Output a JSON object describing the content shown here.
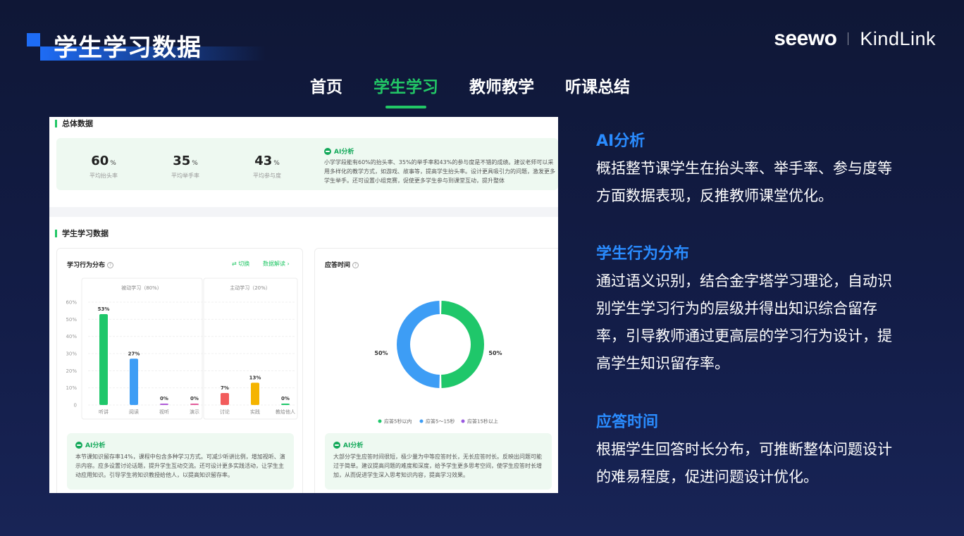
{
  "header": {
    "title": "学生学习数据",
    "brand_left": "seewo",
    "brand_right": "KindLink"
  },
  "nav": {
    "tabs": [
      {
        "label": "首页",
        "active": false
      },
      {
        "label": "学生学习",
        "active": true
      },
      {
        "label": "教师教学",
        "active": false
      },
      {
        "label": "听课总结",
        "active": false
      }
    ]
  },
  "overall": {
    "section_title": "总体数据",
    "stats": [
      {
        "value": "60",
        "unit": "%",
        "label": "平均抬头率"
      },
      {
        "value": "35",
        "unit": "%",
        "label": "平均举手率"
      },
      {
        "value": "43",
        "unit": "%",
        "label": "平均参与度"
      }
    ],
    "ai_label": "AI分析",
    "ai_text": "小学学段能有60%的抬头率、35%的举手率和43%的参与度是不错的成绩。建议老师可以采用多样化的教学方式，如游戏、故事等，提高学生抬头率。设计更具吸引力的问题，激发更多学生举手。还可设置小组竞赛，促使更多学生参与到课堂互动，提升整体"
  },
  "student": {
    "section_title": "学生学习数据",
    "behavior": {
      "title": "学习行为分布",
      "switch_label": "⇄ 切换",
      "data_label": "数据解读 ›",
      "passive_label": "被动学习（80%）",
      "active_label": "主动学习（20%）",
      "ai_label": "AI分析",
      "ai_text": "本节课知识留存率14%，课程中包含多种学习方式。可减少听讲比例，增加视听、演示内容。应多设置讨论话题，提升学生互动交流。还可设计更多实践活动，让学生主动应用知识。引导学生将知识教授给他人，以提高知识留存率。"
    },
    "response": {
      "title": "应答时间",
      "ai_label": "AI分析",
      "ai_text": "大部分学生应答时间很短，极少量为中等应答时长，无长应答时长。反映出问题可能过于简单。建议提高问题的难度和深度，给予学生更多思考空间，使学生应答时长增加，从而促进学生深入思考知识内容，提高学习效果。"
    }
  },
  "chart_data": [
    {
      "type": "bar",
      "title": "学习行为分布",
      "categories": [
        "听讲",
        "阅读",
        "视听",
        "演示",
        "讨论",
        "实践",
        "教给他人"
      ],
      "values": [
        53,
        27,
        0,
        0,
        7,
        13,
        0
      ],
      "value_labels": [
        "53%",
        "27%",
        "0%",
        "0%",
        "7%",
        "13%",
        "0%"
      ],
      "colors": [
        "#1fc76a",
        "#3d9df5",
        "#b05ad8",
        "#e25a9a",
        "#f25c5c",
        "#f5b400",
        "#1fc76a"
      ],
      "yticks": [
        "0",
        "10%",
        "20%",
        "30%",
        "40%",
        "50%",
        "60%"
      ],
      "ylim": [
        0,
        60
      ],
      "groups": [
        {
          "name": "被动学习（80%）",
          "categories": [
            "听讲",
            "阅读",
            "视听",
            "演示"
          ]
        },
        {
          "name": "主动学习（20%）",
          "categories": [
            "讨论",
            "实践",
            "教给他人"
          ]
        }
      ],
      "grid": true
    },
    {
      "type": "pie",
      "title": "应答时间",
      "labels": [
        "应答5秒以内",
        "应答5～15秒",
        "应答15秒以上"
      ],
      "values": [
        50,
        50,
        0
      ],
      "value_labels": [
        "50%",
        "50%"
      ],
      "colors": [
        "#1fc76a",
        "#3d9df5",
        "#9a5ae0"
      ],
      "legend": "bottom"
    }
  ],
  "descriptions": [
    {
      "title": "AI分析",
      "text": "概括整节课学生在抬头率、举手率、参与度等方面数据表现，反推教师课堂优化。"
    },
    {
      "title": "学生行为分布",
      "text": "通过语义识别，结合金字塔学习理论，自动识别学生学习行为的层级并得出知识综合留存率，引导教师通过更高层的学习行为设计，提高学生知识留存率。"
    },
    {
      "title": "应答时间",
      "text": "根据学生回答时长分布，可推断整体问题设计的难易程度，促进问题设计优化。"
    }
  ]
}
